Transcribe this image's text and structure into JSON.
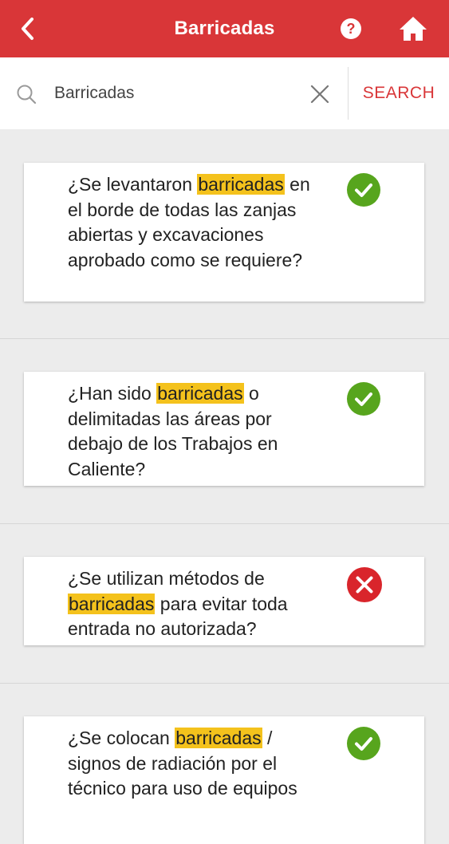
{
  "header": {
    "title": "Barricadas",
    "icons": {
      "back": "chevron-left-icon",
      "help": "help-circle-icon",
      "home": "home-icon"
    }
  },
  "search": {
    "query": "Barricadas",
    "button_label": "SEARCH",
    "icons": {
      "search": "search-icon",
      "clear": "close-icon"
    }
  },
  "results": [
    {
      "text_before": "¿Se levantaron ",
      "highlight": "barricadas",
      "text_after": " en el borde de todas las zanjas abiertas y excavaciones aprobado como se requiere?",
      "status": "ok",
      "status_icon": "check-circle-icon"
    },
    {
      "text_before": "¿Han sido ",
      "highlight": "barricadas",
      "text_after": " o delimitadas las áreas por debajo de los Trabajos en Caliente?",
      "status": "ok",
      "status_icon": "check-circle-icon"
    },
    {
      "text_before": "¿Se utilizan métodos de ",
      "highlight": "barricadas",
      "text_after": " para evitar toda entrada no autorizada?",
      "status": "fail",
      "status_icon": "x-circle-icon"
    },
    {
      "text_before": "¿Se colocan ",
      "highlight": "barricadas",
      "text_after": " / signos de radiación por el técnico para uso de equipos",
      "status": "ok",
      "status_icon": "check-circle-icon"
    }
  ],
  "colors": {
    "brand_red": "#d93638",
    "highlight_yellow": "#f4c21c",
    "ok_green": "#57a51d",
    "fail_red": "#d9252b",
    "background": "#ececec"
  }
}
